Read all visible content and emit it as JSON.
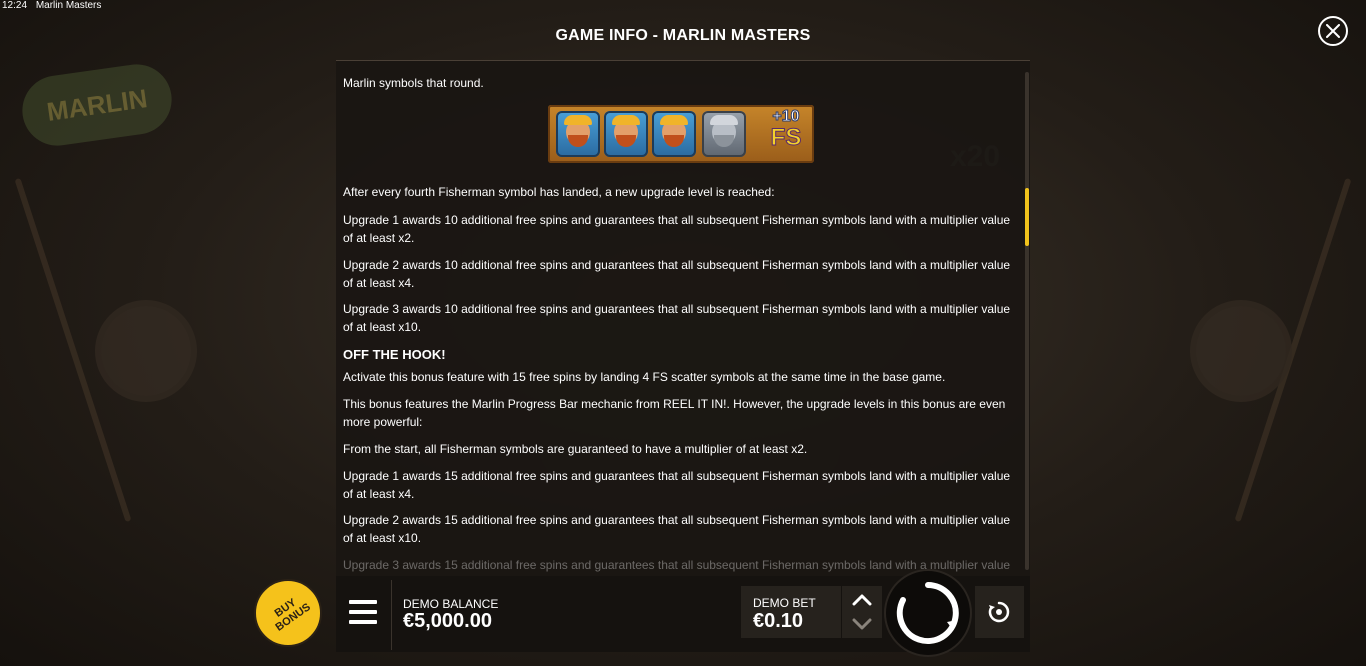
{
  "system": {
    "time": "12:24",
    "app_name": "Marlin Masters"
  },
  "header": {
    "title": "GAME INFO - MARLIN MASTERS"
  },
  "info": {
    "lines": [
      "Marlin symbols that round.",
      "After every fourth Fisherman symbol has landed, a new upgrade level is reached:",
      "Upgrade 1 awards 10 additional free spins and guarantees that all subsequent Fisherman symbols land with a multiplier value of at least x2.",
      "Upgrade 2 awards 10 additional free spins and guarantees that all subsequent Fisherman symbols land with a multiplier value of at least x4.",
      "Upgrade 3 awards 10 additional free spins and guarantees that all subsequent Fisherman symbols land with a multiplier value of at least x10.",
      "Activate this bonus feature with 15 free spins by landing 4 FS scatter symbols at the same time in the base game.",
      "This bonus features the Marlin Progress Bar mechanic from REEL IT IN!. However, the upgrade levels in this bonus are even more powerful:",
      "From the start, all Fisherman symbols are guaranteed to have a multiplier of at least x2.",
      "Upgrade 1 awards 15 additional free spins and guarantees that all subsequent Fisherman symbols land with a multiplier value of at least x4.",
      "Upgrade 2 awards 15 additional free spins and guarantees that all subsequent Fisherman symbols land with a multiplier value of at least x10.",
      "Upgrade 3 awards 15 additional free spins and guarantees that all subsequent Fisherman symbols land with a multiplier value of at"
    ],
    "heading_off_the_hook": "OFF THE HOOK!",
    "badge_plus": "+10",
    "badge_fs": "FS"
  },
  "background": {
    "x20_label": "x20",
    "logo_text": "MARLIN"
  },
  "bottom": {
    "buy_bonus_label": "BUY BONUS",
    "balance_label": "DEMO BALANCE",
    "balance_value": "€5,000.00",
    "bet_label": "DEMO BET",
    "bet_value": "€0.10"
  },
  "colors": {
    "accent": "#f5c21b",
    "scroll_thumb": "#f2c31c",
    "panel_bg": "#1a1612"
  }
}
